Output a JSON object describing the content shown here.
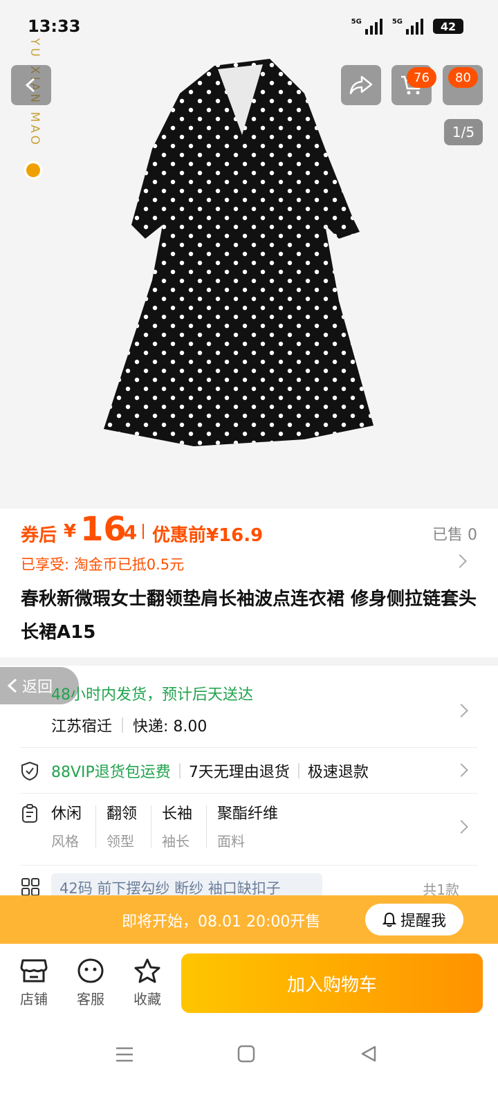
{
  "status": {
    "time": "13:33",
    "signal1": "5G",
    "signal2": "5G",
    "battery": "42"
  },
  "hero": {
    "watermark": "YU XIAN MAO",
    "cart_badge": "76",
    "more_badge": "80",
    "pager": "1/5"
  },
  "price": {
    "after_label": "券后",
    "currency": "¥",
    "integer": "16",
    "decimal": ".4",
    "before": "优惠前¥16.9",
    "sold": "已售 0"
  },
  "coin_note": "已享受: 淘金币已抵0.5元",
  "product_title": "春秋新微瑕女士翻领垫肩长袖波点连衣裙  修身侧拉链套头长裙A15",
  "shipping": {
    "return_label": "返回",
    "promise": "48小时内发货，预计后天送达",
    "origin": "江苏宿迁",
    "fee": "快递: 8.00"
  },
  "services": {
    "vip": "88VIP退货包运费",
    "no_reason": "7天无理由退货",
    "fast_refund": "极速退款"
  },
  "attributes": [
    {
      "value": "休闲",
      "key": "风格"
    },
    {
      "value": "翻领",
      "key": "领型"
    },
    {
      "value": "长袖",
      "key": "袖长"
    },
    {
      "value": "聚酯纤维",
      "key": "面料"
    }
  ],
  "sku": {
    "summary": "42码  前下摆勾纱 断纱 袖口缺扣子",
    "count": "共1款"
  },
  "sale_banner": {
    "text": "即将开始，08.01 20:00开售",
    "remind": "提醒我"
  },
  "bottom": {
    "store": "店铺",
    "service": "客服",
    "favorite": "收藏",
    "add_to_cart": "加入购物车"
  },
  "colors": {
    "accent": "#ff5000",
    "green": "#21a34d",
    "banner": "#ffb534"
  }
}
